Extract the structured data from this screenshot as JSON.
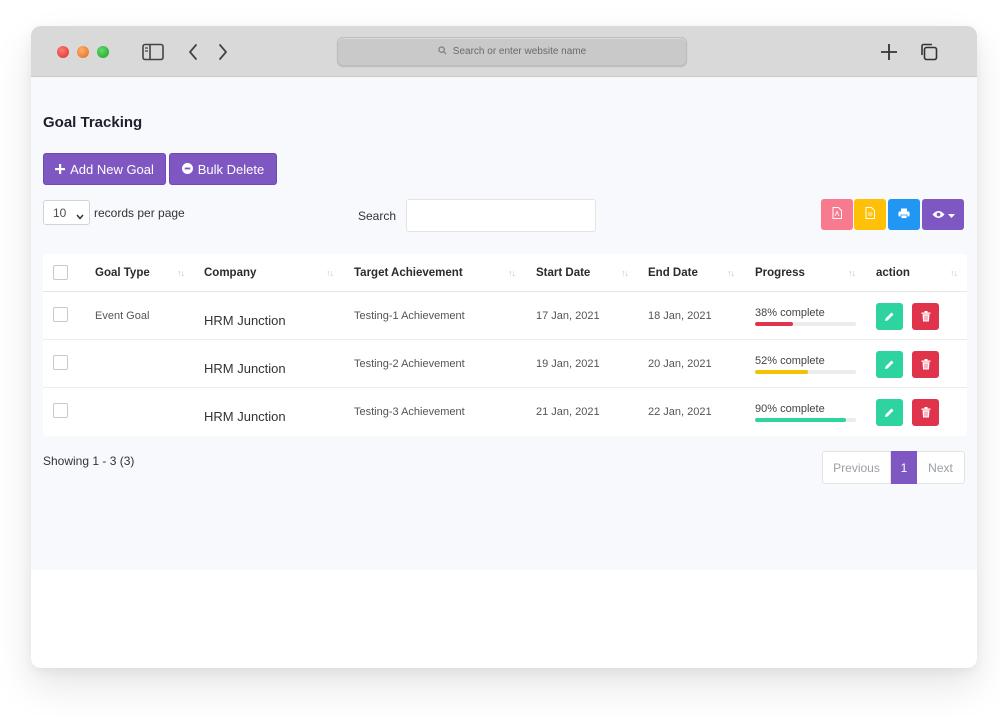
{
  "browser": {
    "address_placeholder": "Search or enter website name"
  },
  "page": {
    "title": "Goal Tracking",
    "add_button": "Add New Goal",
    "bulk_delete_button": "Bulk Delete",
    "per_page_value": "10",
    "per_page_label": "records per page",
    "search_label": "Search",
    "search_value": ""
  },
  "table": {
    "columns": [
      "Goal Type",
      "Company",
      "Target Achievement",
      "Start Date",
      "End Date",
      "Progress",
      "action"
    ],
    "rows": [
      {
        "goal_type": "Event Goal",
        "company": "HRM Junction",
        "target": "Testing-1 Achievement",
        "start": "17 Jan, 2021",
        "end": "18 Jan, 2021",
        "progress_label": "38% complete",
        "progress": 38,
        "bar_color": "#e0344d"
      },
      {
        "goal_type": "",
        "company": "HRM Junction",
        "target": "Testing-2 Achievement",
        "start": "19 Jan, 2021",
        "end": "20 Jan, 2021",
        "progress_label": "52% complete",
        "progress": 52,
        "bar_color": "#f5c000"
      },
      {
        "goal_type": "",
        "company": "HRM Junction",
        "target": "Testing-3 Achievement",
        "start": "21 Jan, 2021",
        "end": "22 Jan, 2021",
        "progress_label": "90% complete",
        "progress": 90,
        "bar_color": "#2dd4a0"
      }
    ]
  },
  "footer": {
    "showing": "Showing 1 - 3 (3)",
    "previous": "Previous",
    "current_page": "1",
    "next": "Next"
  },
  "colors": {
    "accent": "#7e57c2",
    "edit": "#2dd4a0",
    "delete": "#e0344d"
  },
  "icons": [
    "sidebar-icon",
    "back-icon",
    "forward-icon",
    "search-icon",
    "new-tab-icon",
    "tabs-icon",
    "plus-icon",
    "minus-circle-icon",
    "pdf-icon",
    "csv-icon",
    "print-icon",
    "eye-icon",
    "pencil-icon",
    "trash-icon"
  ]
}
